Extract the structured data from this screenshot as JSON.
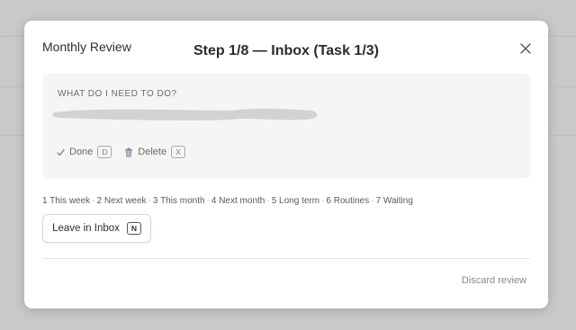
{
  "modal": {
    "title": "Monthly Review",
    "step": "Step 1/8 — Inbox (Task 1/3)",
    "close_icon": "close-icon"
  },
  "task": {
    "label": "WHAT DO I NEED TO DO?",
    "actions": [
      {
        "icon": "checkmark-icon",
        "label": "Done",
        "shortcut": "D"
      },
      {
        "icon": "trash-icon",
        "label": "Delete",
        "shortcut": "X"
      }
    ]
  },
  "destinations": [
    "1 This week",
    "2 Next week",
    "3 This month",
    "4 Next month",
    "5 Long term",
    "6 Routines",
    "7 Waiting"
  ],
  "leave_button": {
    "label": "Leave in Inbox",
    "shortcut": "N"
  },
  "discard_label": "Discard review"
}
